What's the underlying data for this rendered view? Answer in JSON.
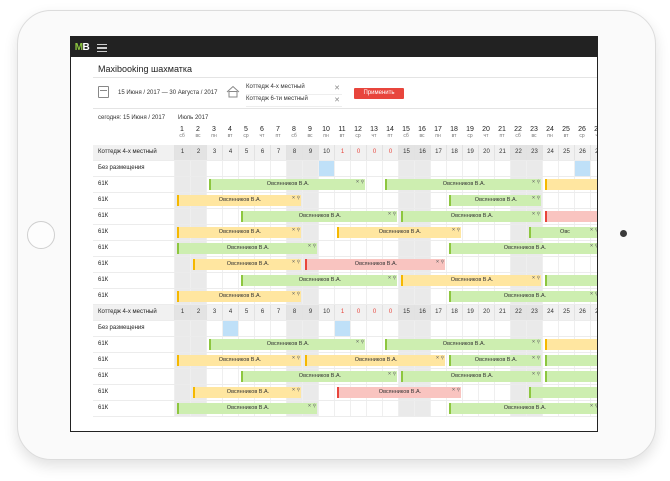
{
  "brand": {
    "logo_m": "M",
    "logo_b": "B"
  },
  "title": "Maxibooking шахматка",
  "filters": {
    "date_range": "15 Июня / 2017 — 30 Августа / 2017",
    "rooms": [
      {
        "label": "Коттедж 4-х местный",
        "remove": "✕"
      },
      {
        "label": "Коттедж 6-ти местный",
        "remove": "✕"
      }
    ],
    "apply_label": "Применить"
  },
  "today": "сегодня: 15 Июня / 2017",
  "month": "Июль 2017",
  "colors": {
    "green": "#8dc63f",
    "orange": "#f5b800",
    "red": "#e8453c",
    "blue": "#bfe0f8"
  },
  "days": [
    {
      "n": "1",
      "w": "сб"
    },
    {
      "n": "2",
      "w": "вс"
    },
    {
      "n": "3",
      "w": "пн"
    },
    {
      "n": "4",
      "w": "вт"
    },
    {
      "n": "5",
      "w": "ср"
    },
    {
      "n": "6",
      "w": "чт"
    },
    {
      "n": "7",
      "w": "пт"
    },
    {
      "n": "8",
      "w": "сб"
    },
    {
      "n": "9",
      "w": "вс"
    },
    {
      "n": "10",
      "w": "пн"
    },
    {
      "n": "11",
      "w": "вт"
    },
    {
      "n": "12",
      "w": "ср"
    },
    {
      "n": "13",
      "w": "чт"
    },
    {
      "n": "14",
      "w": "пт"
    },
    {
      "n": "15",
      "w": "сб"
    },
    {
      "n": "16",
      "w": "вс"
    },
    {
      "n": "17",
      "w": "пн"
    },
    {
      "n": "18",
      "w": "вт"
    },
    {
      "n": "19",
      "w": "ср"
    },
    {
      "n": "20",
      "w": "чт"
    },
    {
      "n": "21",
      "w": "пт"
    },
    {
      "n": "22",
      "w": "сб"
    },
    {
      "n": "23",
      "w": "вс"
    },
    {
      "n": "24",
      "w": "пн"
    },
    {
      "n": "25",
      "w": "вт"
    },
    {
      "n": "26",
      "w": "ср"
    },
    {
      "n": "27",
      "w": "чт"
    }
  ],
  "sections": [
    {
      "label": "Коттедж 4-х местный",
      "counts": [
        "1",
        "2",
        "3",
        "4",
        "5",
        "6",
        "7",
        "8",
        "9",
        "10",
        "1",
        "0",
        "0",
        "0",
        "15",
        "16",
        "17",
        "18",
        "19",
        "20",
        "21",
        "22",
        "23",
        "24",
        "25",
        "26",
        "27"
      ],
      "red_count_days": [
        11,
        12,
        13,
        14
      ],
      "unplaced_label": "Без размещения",
      "unplaced_selected_days": [
        10,
        26
      ],
      "rows": [
        {
          "label": "61К",
          "bars": [
            {
              "s": 3,
              "e": 13,
              "t": "Овсянников В.А.",
              "c": "g"
            },
            {
              "s": 14,
              "e": 24,
              "t": "Овсянников В.А.",
              "c": "g"
            },
            {
              "s": 24,
              "e": 28,
              "t": "",
              "c": "o"
            }
          ]
        },
        {
          "label": "61К",
          "bars": [
            {
              "s": 1,
              "e": 9,
              "t": "Овсянников В.А.",
              "c": "o"
            },
            {
              "s": 18,
              "e": 24,
              "t": "Овсянников В.А.",
              "c": "g"
            }
          ]
        },
        {
          "label": "61К",
          "bars": [
            {
              "s": 5,
              "e": 15,
              "t": "Овсянников В.А.",
              "c": "g"
            },
            {
              "s": 15,
              "e": 24,
              "t": "Овсянников В.А.",
              "c": "g"
            },
            {
              "s": 24,
              "e": 28,
              "t": "",
              "c": "r"
            }
          ]
        },
        {
          "label": "61К",
          "bars": [
            {
              "s": 1,
              "e": 9,
              "t": "Овсянников В.А.",
              "c": "o"
            },
            {
              "s": 11,
              "e": 19,
              "t": "Овсянников В.А.",
              "c": "o"
            },
            {
              "s": 23,
              "e": 28,
              "t": "Овс",
              "c": "g"
            }
          ]
        },
        {
          "label": "61К",
          "bars": [
            {
              "s": 1,
              "e": 10,
              "t": "Овсянников В.А.",
              "c": "g"
            },
            {
              "s": 18,
              "e": 28,
              "t": "Овсянников В.А.",
              "c": "g"
            }
          ]
        },
        {
          "label": "61К",
          "bars": [
            {
              "s": 2,
              "e": 9,
              "t": "Овсянников В.А.",
              "c": "o"
            },
            {
              "s": 9,
              "e": 18,
              "t": "Овсянников В.А.",
              "c": "r"
            }
          ]
        },
        {
          "label": "61К",
          "bars": [
            {
              "s": 5,
              "e": 15,
              "t": "Овсянников В.А.",
              "c": "g"
            },
            {
              "s": 15,
              "e": 24,
              "t": "Овсянников В.А.",
              "c": "o"
            },
            {
              "s": 24,
              "e": 28,
              "t": "",
              "c": "g"
            }
          ]
        },
        {
          "label": "61К",
          "bars": [
            {
              "s": 1,
              "e": 9,
              "t": "Овсянников В.А.",
              "c": "o"
            },
            {
              "s": 18,
              "e": 28,
              "t": "Овсянников В.А.",
              "c": "g"
            }
          ]
        }
      ]
    },
    {
      "label": "Коттедж 4-х местный",
      "counts": [
        "1",
        "2",
        "3",
        "4",
        "5",
        "6",
        "7",
        "8",
        "9",
        "10",
        "1",
        "0",
        "0",
        "0",
        "15",
        "16",
        "17",
        "18",
        "19",
        "20",
        "21",
        "22",
        "23",
        "24",
        "25",
        "26",
        "27"
      ],
      "red_count_days": [
        11,
        12,
        13,
        14
      ],
      "unplaced_label": "Без размещения",
      "unplaced_selected_days": [
        4,
        11
      ],
      "rows": [
        {
          "label": "61К",
          "bars": [
            {
              "s": 3,
              "e": 13,
              "t": "Овсянников В.А.",
              "c": "g"
            },
            {
              "s": 14,
              "e": 24,
              "t": "Овсянников В.А.",
              "c": "g"
            },
            {
              "s": 24,
              "e": 28,
              "t": "",
              "c": "o"
            }
          ]
        },
        {
          "label": "61К",
          "bars": [
            {
              "s": 1,
              "e": 9,
              "t": "Овсянников В.А.",
              "c": "o"
            },
            {
              "s": 9,
              "e": 18,
              "t": "Овсянников В.А.",
              "c": "o"
            },
            {
              "s": 18,
              "e": 24,
              "t": "Овсянников В.А.",
              "c": "g"
            },
            {
              "s": 24,
              "e": 28,
              "t": "",
              "c": "g"
            }
          ]
        },
        {
          "label": "61К",
          "bars": [
            {
              "s": 5,
              "e": 15,
              "t": "Овсянников В.А.",
              "c": "g"
            },
            {
              "s": 15,
              "e": 24,
              "t": "Овсянников В.А.",
              "c": "g"
            },
            {
              "s": 24,
              "e": 28,
              "t": "",
              "c": "g"
            }
          ]
        },
        {
          "label": "61К",
          "bars": [
            {
              "s": 2,
              "e": 9,
              "t": "Овсянников В.А.",
              "c": "o"
            },
            {
              "s": 11,
              "e": 19,
              "t": "Овсянников В.А.",
              "c": "r"
            },
            {
              "s": 23,
              "e": 28,
              "t": "",
              "c": "g"
            }
          ]
        },
        {
          "label": "61К",
          "bars": [
            {
              "s": 1,
              "e": 10,
              "t": "Овсянников В.А.",
              "c": "g"
            },
            {
              "s": 18,
              "e": 28,
              "t": "Овсянников В.А.",
              "c": "g"
            }
          ]
        }
      ]
    }
  ]
}
